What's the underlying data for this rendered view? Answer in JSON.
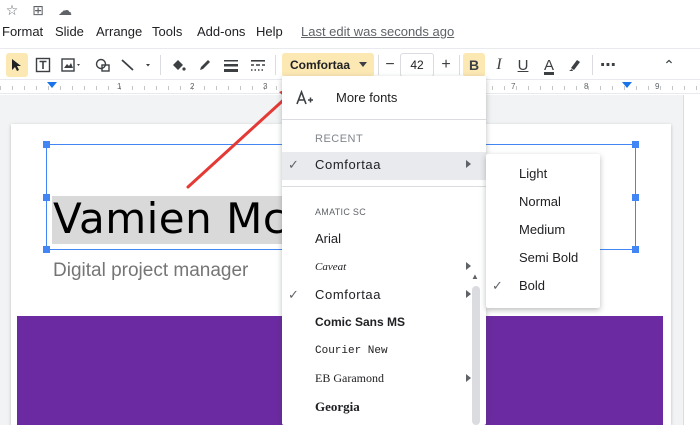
{
  "top_icons": [
    {
      "name": "star-icon",
      "glyph": "☆"
    },
    {
      "name": "move-to-folder-icon",
      "glyph": "⊞"
    },
    {
      "name": "cloud-saved-icon",
      "glyph": "☁"
    }
  ],
  "menu": {
    "items": [
      "Format",
      "Slide",
      "Arrange",
      "Tools",
      "Add-ons",
      "Help"
    ],
    "last_edit": "Last edit was seconds ago"
  },
  "toolbar": {
    "font_name": "Comfortaa",
    "font_size": "42",
    "minus": "−",
    "plus": "+",
    "bold": "B",
    "italic": "I",
    "underline": "U",
    "text_color": "A",
    "more": "⋯",
    "collapse": "⌃"
  },
  "ruler": {
    "labels": [
      "1",
      "2",
      "3",
      "7",
      "8",
      "9"
    ]
  },
  "slide": {
    "title": "Vamien Mck",
    "subtitle": "Digital project manager"
  },
  "font_menu": {
    "more_fonts": "More fonts",
    "recent_heading": "RECENT",
    "recent": [
      {
        "label": "Comfortaa",
        "checked": true,
        "submenu": true
      }
    ],
    "fonts": [
      {
        "label": "AMATIC SC",
        "checked": false,
        "submenu": false
      },
      {
        "label": "Arial",
        "checked": false,
        "submenu": false
      },
      {
        "label": "Caveat",
        "checked": false,
        "submenu": true
      },
      {
        "label": "Comfortaa",
        "checked": true,
        "submenu": true
      },
      {
        "label": "Comic Sans MS",
        "checked": false,
        "submenu": false
      },
      {
        "label": "Courier New",
        "checked": false,
        "submenu": false
      },
      {
        "label": "EB Garamond",
        "checked": false,
        "submenu": true
      },
      {
        "label": "Georgia",
        "checked": false,
        "submenu": false
      }
    ],
    "check_glyph": "✓"
  },
  "weight_menu": {
    "items": [
      {
        "label": "Light",
        "checked": false
      },
      {
        "label": "Normal",
        "checked": false
      },
      {
        "label": "Medium",
        "checked": false
      },
      {
        "label": "Semi Bold",
        "checked": false
      },
      {
        "label": "Bold",
        "checked": true
      }
    ]
  },
  "colors": {
    "accent": "#4285f4",
    "arrow": "#e53935",
    "purple": "#6b2aa1",
    "font_select_bg": "#fce8b2"
  }
}
